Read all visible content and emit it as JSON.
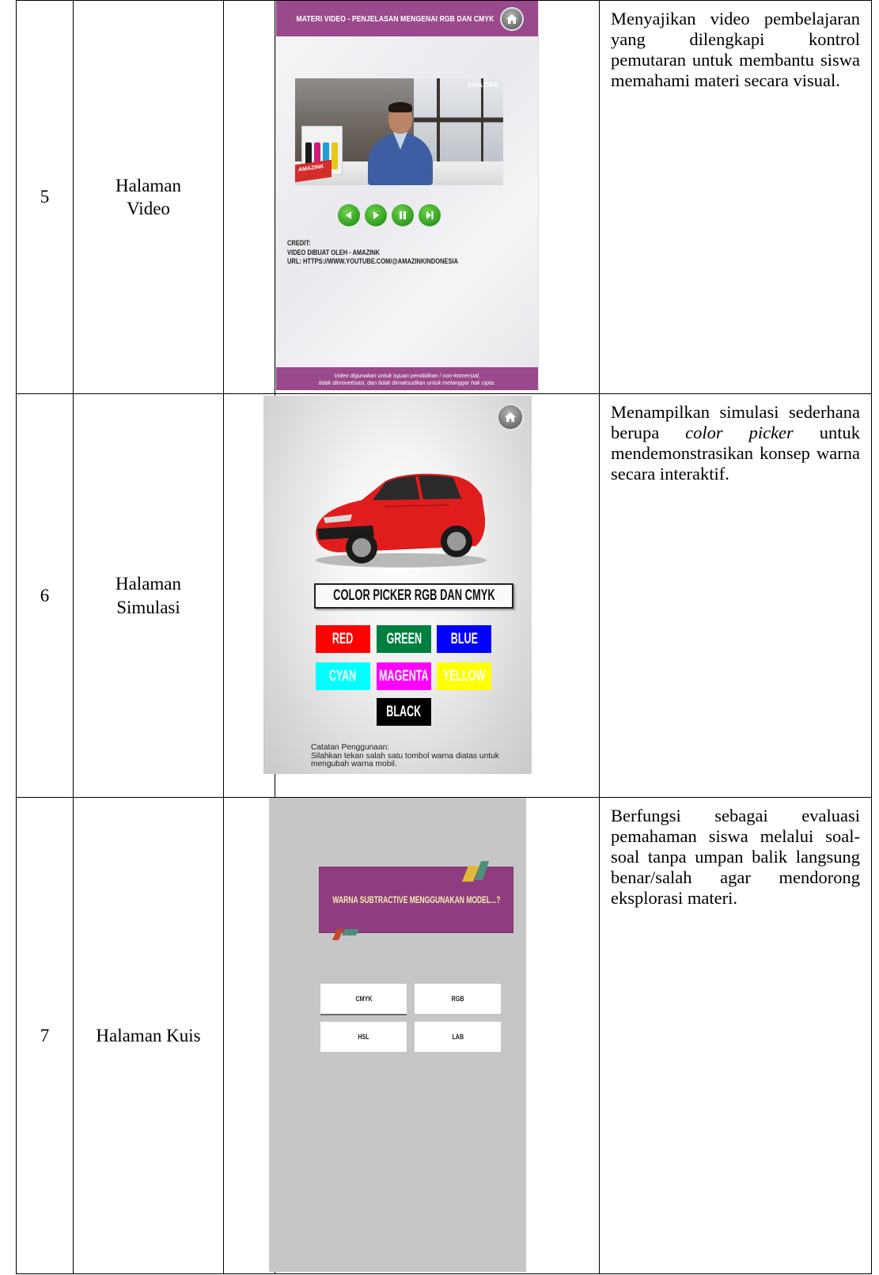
{
  "rows": [
    {
      "no": "5",
      "name_lines": [
        "Halaman",
        "Video"
      ],
      "desc": "Menyajikan video pembelajaran yang dilengkapi kontrol pemutaran untuk membantu siswa memahami materi secara visual.",
      "screenshot": {
        "header_title": "MATERI VIDEO - PENJELASAN MENGENAI RGB DAN CMYK",
        "video_logo": "AMAZINK",
        "box_logo": "AMAZINK",
        "controls": [
          "rewind-icon",
          "play-icon",
          "pause-icon",
          "forward-icon"
        ],
        "credit_lines": [
          "CREDIT:",
          "VIDEO DIBUAT OLEH - AMAZINK",
          "URL: HTTPS://WWW.YOUTUBE.COM/@AMAZINKINDONESIA"
        ],
        "footer_lines": [
          "Video digunakan untuk tujuan pendidikan / non-komersial,",
          "tidak dimonetisasi, dan tidak dimaksudkan untuk melanggar hak cipta."
        ],
        "accent_color": "#9a4a8c",
        "control_color": "#2f9d1e"
      }
    },
    {
      "no": "6",
      "name_lines": [
        "Halaman",
        "Simulasi"
      ],
      "desc_before": "Menampilkan simulasi sederhana berupa ",
      "desc_italic": "color picker",
      "desc_after": " untuk mendemonstrasikan konsep warna secara interaktif.",
      "screenshot": {
        "title": "COLOR PICKER RGB DAN CMYK",
        "buttons": [
          {
            "label": "RED",
            "color": "#ff0000"
          },
          {
            "label": "GREEN",
            "color": "#008040"
          },
          {
            "label": "BLUE",
            "color": "#0000ff"
          },
          {
            "label": "CYAN",
            "color": "#00ffff"
          },
          {
            "label": "MAGENTA",
            "color": "#ff00ff"
          },
          {
            "label": "YELLOW",
            "color": "#ffff00"
          },
          {
            "label": "BLACK",
            "color": "#000000"
          }
        ],
        "car_color": "#e01d1d",
        "note_lines": [
          "Catatan Penggunaan:",
          "Silahkan tekan salah satu tombol warna diatas untuk",
          "mengubah warna mobil."
        ]
      }
    },
    {
      "no": "7",
      "name": "Halaman Kuis",
      "desc": "Berfungsi sebagai evaluasi pemahaman siswa melalui soal-soal tanpa umpan balik langsung benar/salah agar mendorong eksplorasi materi.",
      "screenshot": {
        "question": "WARNA SUBTRACTIVE MENGGUNAKAN MODEL...?",
        "options": [
          "CMYK",
          "RGB",
          "HSL",
          "LAB"
        ],
        "card_color": "#8f3d80",
        "background_color": "#c6c6c6"
      }
    }
  ]
}
